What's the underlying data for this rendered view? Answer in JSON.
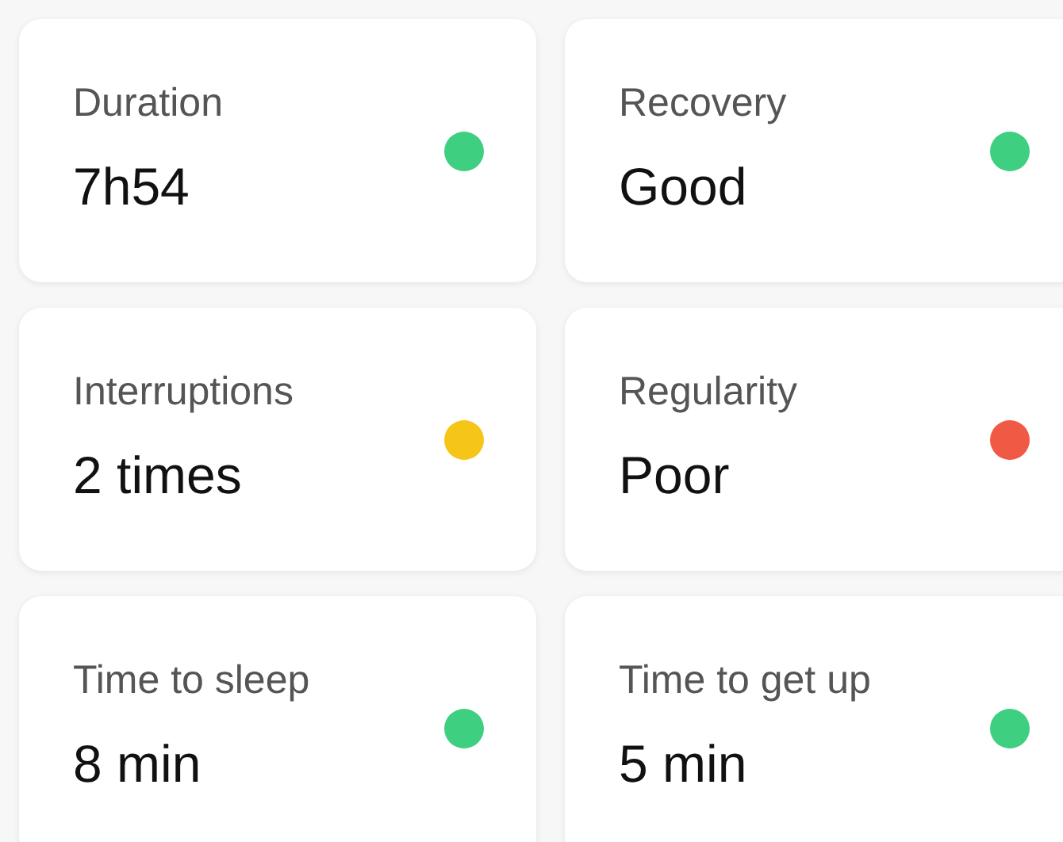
{
  "metrics": [
    {
      "label": "Duration",
      "value": "7h54",
      "color": "#3ecf80"
    },
    {
      "label": "Recovery",
      "value": "Good",
      "color": "#3ecf80"
    },
    {
      "label": "Interruptions",
      "value": "2 times",
      "color": "#f5c518"
    },
    {
      "label": "Regularity",
      "value": "Poor",
      "color": "#f05a44"
    },
    {
      "label": "Time to sleep",
      "value": "8 min",
      "color": "#3ecf80"
    },
    {
      "label": "Time to get up",
      "value": "5 min",
      "color": "#3ecf80"
    }
  ]
}
